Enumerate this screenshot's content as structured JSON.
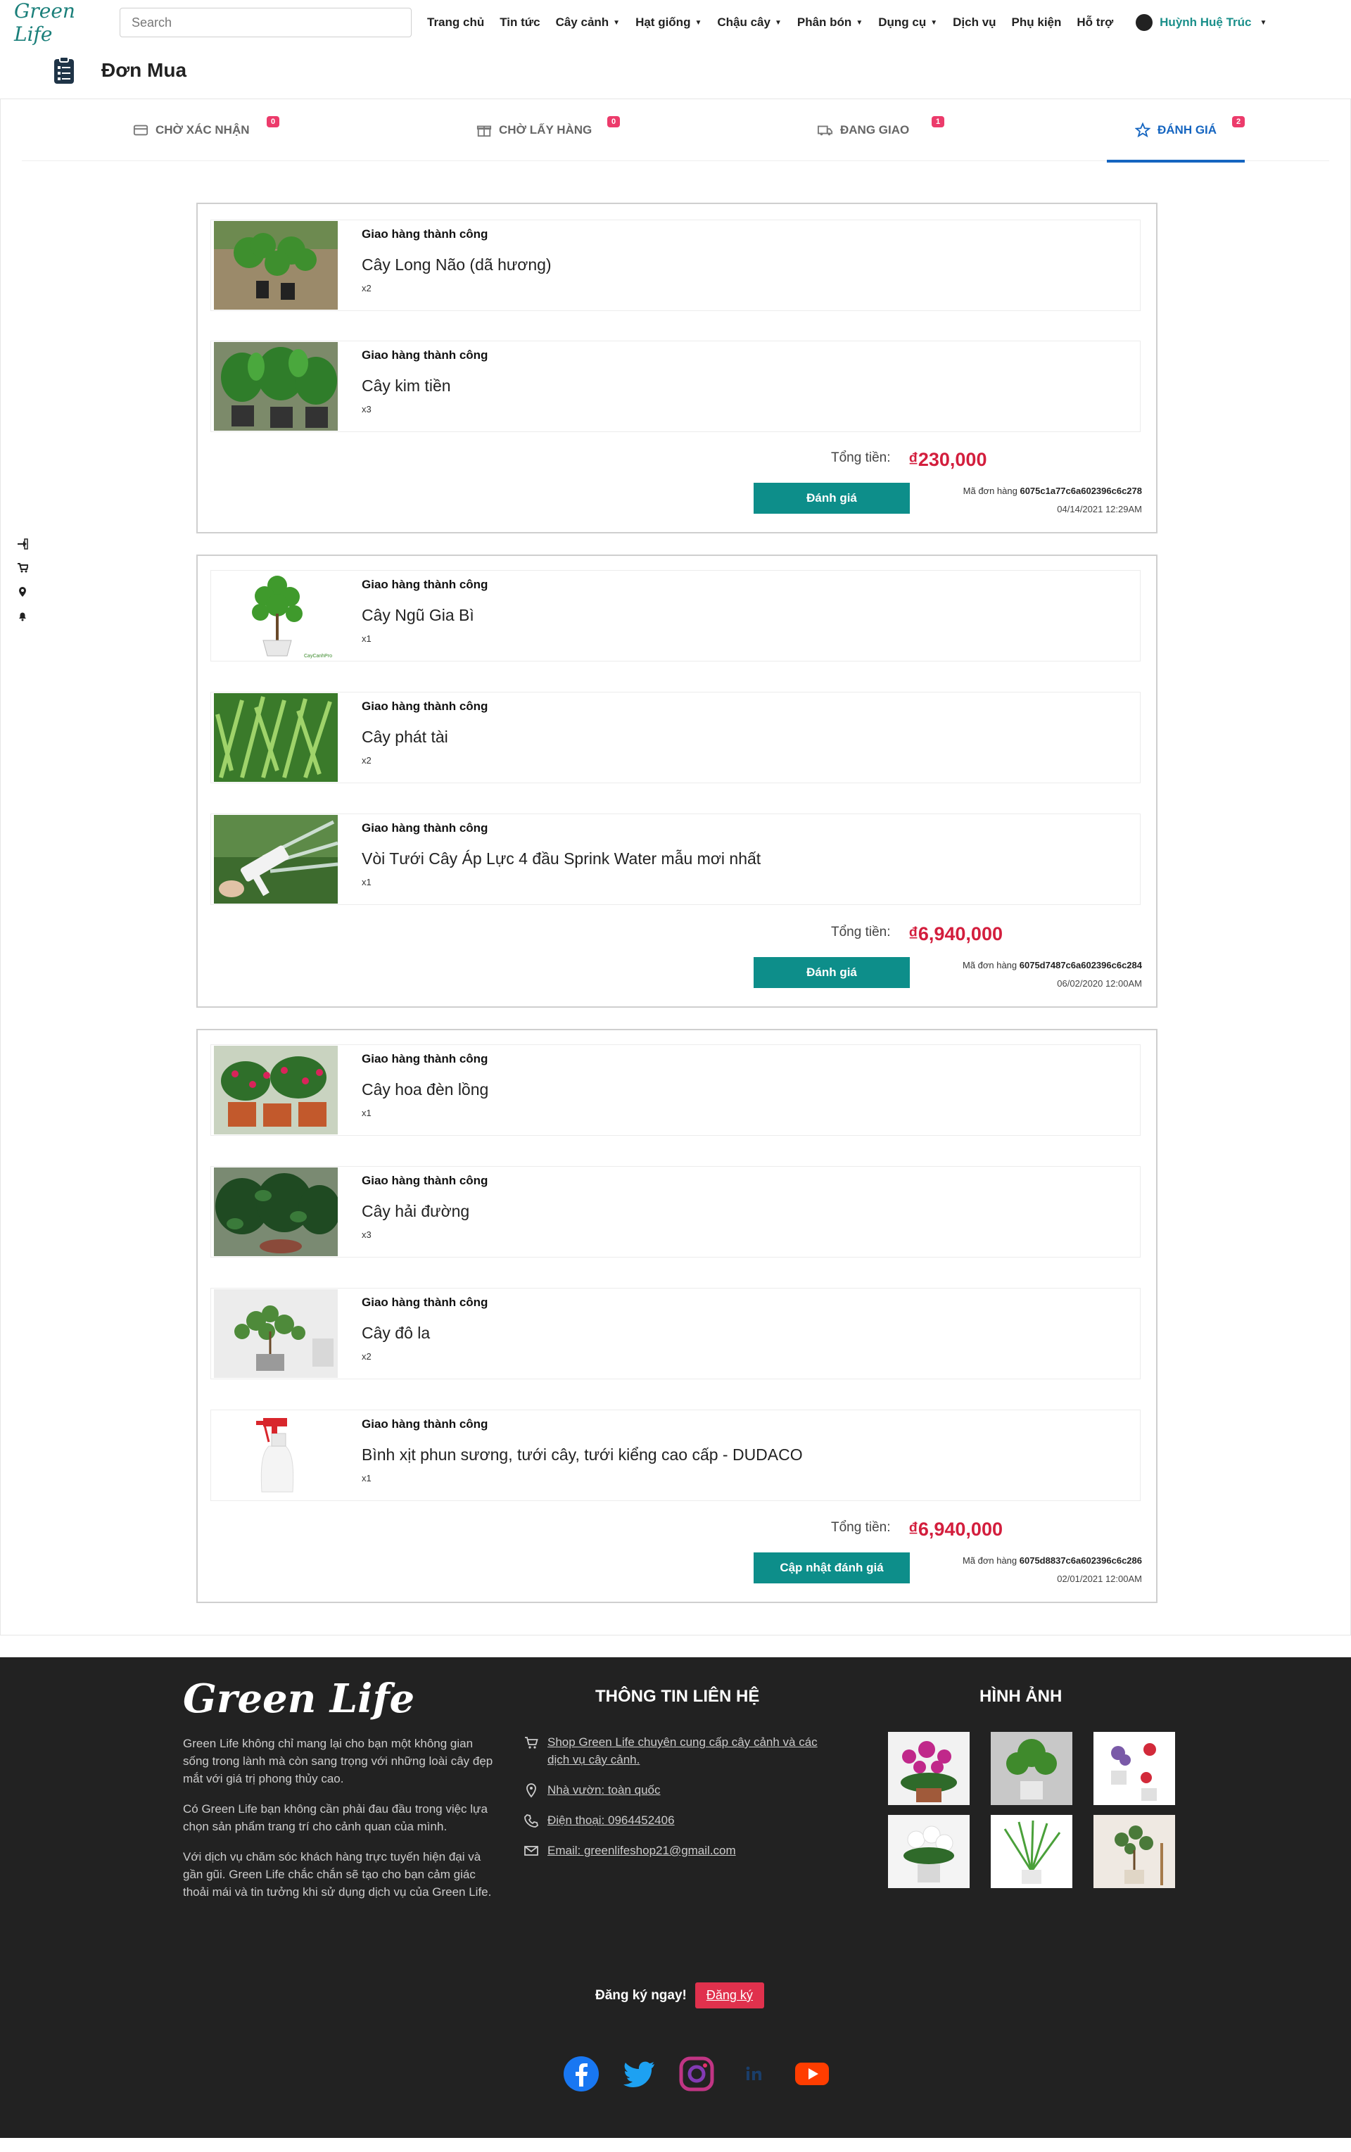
{
  "navbar": {
    "logo": "Green Life",
    "search_placeholder": "Search",
    "menu": [
      {
        "label": "Trang chủ",
        "dropdown": false
      },
      {
        "label": "Tin tức",
        "dropdown": false
      },
      {
        "label": "Cây cảnh",
        "dropdown": true
      },
      {
        "label": "Hạt giống",
        "dropdown": true
      },
      {
        "label": "Chậu cây",
        "dropdown": true
      },
      {
        "label": "Phân bón",
        "dropdown": true
      },
      {
        "label": "Dụng cụ",
        "dropdown": true
      },
      {
        "label": "Dịch vụ",
        "dropdown": false
      },
      {
        "label": "Phụ kiện",
        "dropdown": false
      },
      {
        "label": "Hỗ trợ",
        "dropdown": false
      }
    ],
    "user_name": "Huỳnh Huệ Trúc"
  },
  "page": {
    "title": "Đơn Mua"
  },
  "tabs": [
    {
      "label": "CHỜ XÁC NHẬN",
      "count": "0",
      "icon": "credit-card-icon",
      "active": false
    },
    {
      "label": "CHỜ LẤY HÀNG",
      "count": "0",
      "icon": "gift-icon",
      "active": false
    },
    {
      "label": "ĐANG GIAO",
      "count": "1",
      "icon": "truck-icon",
      "active": false
    },
    {
      "label": "ĐÁNH GIÁ",
      "count": "2",
      "icon": "star-icon",
      "active": true
    }
  ],
  "orders": [
    {
      "items": [
        {
          "status": "Giao hàng thành công",
          "name": "Cây Long Não (dã hương)",
          "qty": "x2"
        },
        {
          "status": "Giao hàng thành công",
          "name": "Cây kim tiền",
          "qty": "x3"
        }
      ],
      "total_label": "Tổng tiền:",
      "total": "₫230,000",
      "button": "Đánh giá",
      "code_label": "Mã đơn hàng",
      "code": "6075c1a77c6a602396c6c278",
      "date": "04/14/2021 12:29AM"
    },
    {
      "items": [
        {
          "status": "Giao hàng thành công",
          "name": "Cây Ngũ Gia Bì",
          "qty": "x1"
        },
        {
          "status": "Giao hàng thành công",
          "name": "Cây phát tài",
          "qty": "x2"
        },
        {
          "status": "Giao hàng thành công",
          "name": "Vòi Tưới Cây Áp Lực 4 đầu Sprink Water mẫu mơi nhất",
          "qty": "x1"
        }
      ],
      "total_label": "Tổng tiền:",
      "total": "₫6,940,000",
      "button": "Đánh giá",
      "code_label": "Mã đơn hàng",
      "code": "6075d7487c6a602396c6c284",
      "date": "06/02/2020 12:00AM"
    },
    {
      "items": [
        {
          "status": "Giao hàng thành công",
          "name": "Cây hoa đèn lồng",
          "qty": "x1"
        },
        {
          "status": "Giao hàng thành công",
          "name": "Cây hải đường",
          "qty": "x3"
        },
        {
          "status": "Giao hàng thành công",
          "name": "Cây đô la",
          "qty": "x2"
        },
        {
          "status": "Giao hàng thành công",
          "name": "Bình xịt phun sương, tưới cây, tưới kiểng cao cấp - DUDACO",
          "qty": "x1"
        }
      ],
      "total_label": "Tổng tiền:",
      "total": "₫6,940,000",
      "button": "Cập nhật đánh giá",
      "code_label": "Mã đơn hàng",
      "code": "6075d8837c6a602396c6c286",
      "date": "02/01/2021 12:00AM"
    }
  ],
  "footer": {
    "logo": "Green Life",
    "desc": [
      "Green Life không chỉ mang lại cho bạn một không gian sống trong lành mà còn sang trọng với những loài cây đẹp mắt với giá trị phong thủy cao.",
      "Có Green Life bạn không cần phải đau đầu trong việc lựa chọn sản phẩm trang trí cho cảnh quan của mình.",
      "Với dịch vụ chăm sóc khách hàng trực tuyến hiện đại và gần gũi. Green Life chắc chắn sẽ tạo cho bạn cảm giác thoải mái và tin tưởng khi sử dụng dịch vụ của Green Life."
    ],
    "contact_heading": "THÔNG TIN LIÊN HỆ",
    "contact": [
      {
        "icon": "cart-icon",
        "text": "Shop Green Life chuyên cung cấp cây cảnh và các dịch vụ cây cảnh."
      },
      {
        "icon": "map-pin-icon",
        "text": "Nhà vườn: toàn quốc"
      },
      {
        "icon": "phone-icon",
        "text": "Điện thoại: 0964452406"
      },
      {
        "icon": "mail-icon",
        "text": "Email: greenlifeshop21@gmail.com"
      }
    ],
    "gallery_heading": "HÌNH ẢNH",
    "subscribe_label": "Đăng ký ngay!",
    "subscribe_button": "Đăng ký",
    "social": [
      "facebook-icon",
      "twitter-icon",
      "instagram-icon",
      "linkedin-icon",
      "youtube-icon"
    ]
  },
  "colors": {
    "brand": "#0d8e8a",
    "price": "#d31e3d",
    "active_tab": "#1565c0",
    "badge": "#ec3b6b",
    "footer_bg": "#222222"
  }
}
